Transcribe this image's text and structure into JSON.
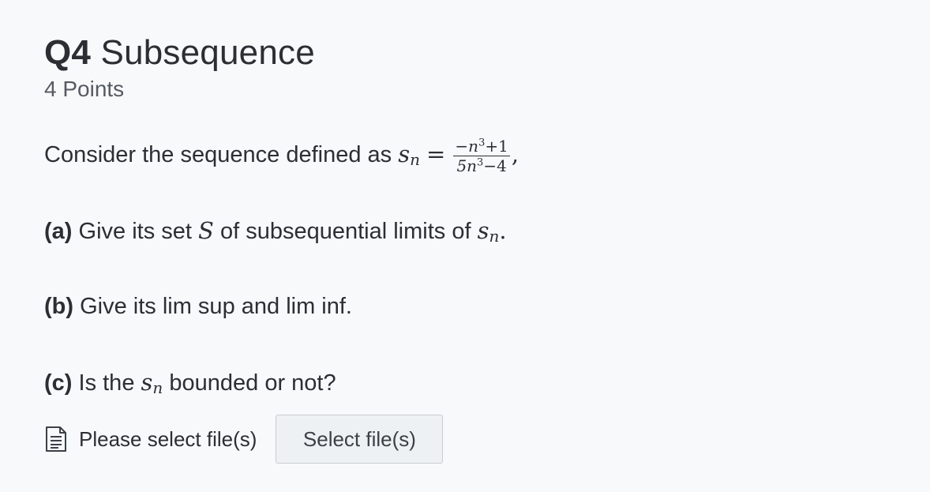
{
  "question": {
    "number": "Q4",
    "title": "Subsequence",
    "points": "4 Points",
    "intro_text": "Consider the sequence defined as",
    "sequence_symbol": "s",
    "sequence_index": "n",
    "equals": "=",
    "fraction_numerator_prefix": "−n",
    "fraction_numerator_exponent": "3",
    "fraction_numerator_suffix": "+1",
    "fraction_denominator_prefix": "5n",
    "fraction_denominator_exponent": "3",
    "fraction_denominator_suffix": "−4",
    "trailing_comma": ",",
    "parts": [
      {
        "label": "(a)",
        "text_before": "Give its set",
        "math_symbol": "S",
        "text_after": "of subsequential limits of",
        "end_punct": "."
      },
      {
        "label": "(b)",
        "text": "Give its lim sup and lim inf."
      },
      {
        "label": "(c)",
        "text_before": "Is the",
        "text_after": "bounded or not?"
      }
    ]
  },
  "upload": {
    "icon": "file-document-icon",
    "label": "Please select file(s)",
    "button_label": "Select file(s)"
  }
}
